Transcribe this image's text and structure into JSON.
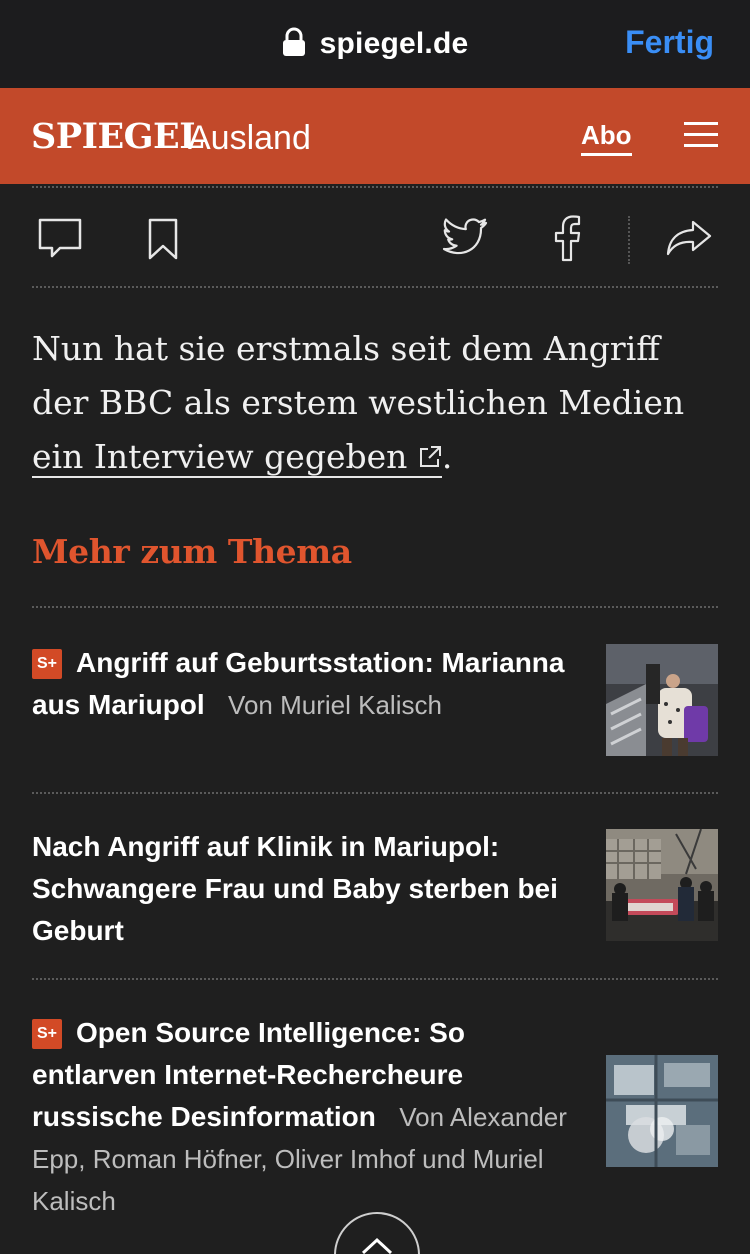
{
  "browser": {
    "url": "spiegel.de",
    "done_label": "Fertig",
    "icons": [
      "lock-icon"
    ]
  },
  "header": {
    "brand": "SPIEGEL",
    "section": "Ausland",
    "abo_label": "Abo",
    "icons": [
      "menu-icon"
    ]
  },
  "actions": {
    "icons": [
      "comment-icon",
      "bookmark-icon",
      "twitter-icon",
      "facebook-icon",
      "share-icon"
    ]
  },
  "article": {
    "text_before": "Nun hat sie erstmals seit dem Angriff der BBC als erstem westlichen Medien ",
    "link_part1": "ein",
    "link_part2": "Interview gegeben",
    "text_after": "."
  },
  "more": {
    "title": "Mehr zum Thema",
    "items": [
      {
        "badge": "S+",
        "title": "Angriff auf Geburtsstation: Marianna aus Mariupol",
        "author": "Von Muriel Kalisch"
      },
      {
        "badge": "",
        "title": "Nach Angriff auf Klinik in Mariupol: Schwangere Frau und Baby sterben bei Geburt",
        "author": ""
      },
      {
        "badge": "S+",
        "title": "Open Source Intelligence: So entlarven Internet-Rechercheure russische Desinformation",
        "author": "Von Alexander Epp, Roman Höfner, Oliver Imhof und Muriel Kalisch"
      }
    ]
  },
  "colors": {
    "header_bg": "#c2492a",
    "accent": "#e0552e",
    "link_blue": "#3a8ef6",
    "background": "#1f1f1f"
  }
}
